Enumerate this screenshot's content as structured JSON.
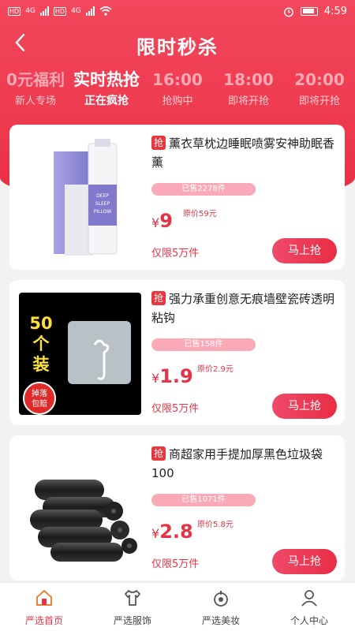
{
  "status": {
    "carrier1": "4G",
    "carrier2": "4G",
    "time": "4:59"
  },
  "nav": {
    "title": "限时秒杀"
  },
  "tabs": [
    {
      "top": "0元福利",
      "bottom": "新人专场"
    },
    {
      "top": "实时热抢",
      "bottom": "正在疯抢"
    },
    {
      "top": "16:00",
      "bottom": "抢购中"
    },
    {
      "top": "18:00",
      "bottom": "即将开抢"
    },
    {
      "top": "20:00",
      "bottom": "即将开抢"
    }
  ],
  "products": [
    {
      "badge": "抢",
      "name": "薰衣草枕边睡眠喷雾安神助眠香薰",
      "sold": "已售2278件",
      "currency": "¥",
      "price": "9",
      "original": "原价59元",
      "limit": "仅限5万件",
      "button": "马上抢",
      "image_text": [
        "DEEP",
        "SLEEP",
        "PILLOW"
      ]
    },
    {
      "badge": "抢",
      "name": "强力承重创意无痕墙壁瓷砖透明粘钩",
      "sold": "已售158件",
      "currency": "¥",
      "price": "1.9",
      "original": "原价2.9元",
      "limit": "仅限5万件",
      "button": "马上抢",
      "image_text": [
        "50",
        "个",
        "装",
        "掉落",
        "包赔"
      ]
    },
    {
      "badge": "抢",
      "name": "商超家用手提加厚黑色垃圾袋100",
      "sold": "已售1071件",
      "currency": "¥",
      "price": "2.8",
      "original": "原价5.8元",
      "limit": "仅限5万件",
      "button": "马上抢"
    }
  ],
  "bottom_nav": [
    {
      "label": "严选首页",
      "icon": "home-icon"
    },
    {
      "label": "严选服饰",
      "icon": "shirt-icon"
    },
    {
      "label": "严选美妆",
      "icon": "cosmetics-icon"
    },
    {
      "label": "个人中心",
      "icon": "user-icon"
    }
  ]
}
